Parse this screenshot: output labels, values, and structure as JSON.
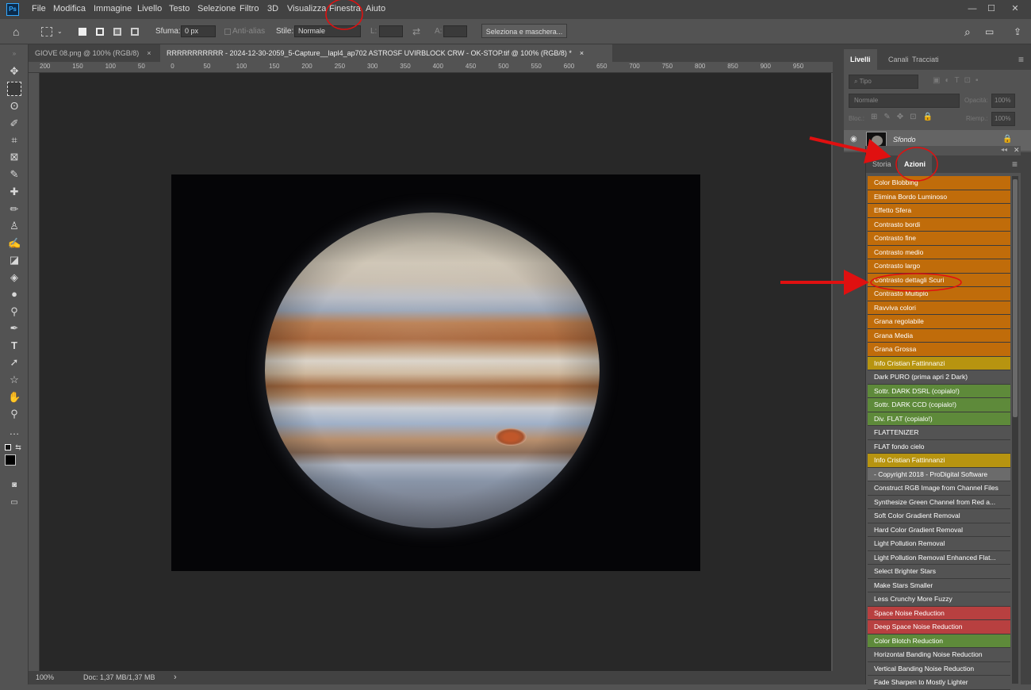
{
  "menubar": {
    "logo": "Ps",
    "items": [
      "File",
      "Modifica",
      "Immagine",
      "Livello",
      "Testo",
      "Selezione",
      "Filtro",
      "3D",
      "Visualizza",
      "Finestra",
      "Aiuto"
    ]
  },
  "options": {
    "sfuma_label": "Sfuma:",
    "sfuma_value": "0 px",
    "antialias_label": "Anti-alias",
    "stile_label": "Stile:",
    "stile_value": "Normale",
    "l_label": "L:",
    "a_label": "A:",
    "mask_button": "Seleziona e maschera..."
  },
  "doc_tabs": [
    {
      "label": "GIOVE 08.png @ 100% (RGB/8)",
      "close": "×"
    },
    {
      "label": "RRRRRRRRRRR - 2024-12-30-2059_5-Capture__lapl4_ap702 ASTROSF UVIRBLOCK CRW - OK-STOP.tif @ 100% (RGB/8) *",
      "close": "×"
    }
  ],
  "ruler_labels": [
    "200",
    "150",
    "100",
    "50",
    "0",
    "50",
    "100",
    "150",
    "200",
    "250",
    "300",
    "350",
    "400",
    "450",
    "500",
    "550",
    "600",
    "650",
    "700",
    "750",
    "800",
    "850",
    "900",
    "950"
  ],
  "statusbar": {
    "zoom": "100%",
    "doc": "Doc: 1,37 MB/1,37 MB",
    "arrow": "›"
  },
  "layers_panel": {
    "tabs": [
      "Livelli",
      "Canali",
      "Tracciati"
    ],
    "filter_placeholder": "Tipo",
    "blend_mode": "Normale",
    "opacity_label": "Opacità:",
    "opacity_value": "100%",
    "lock_label": "Bloc.:",
    "fill_label": "Riemp.:",
    "fill_value": "100%",
    "layer_name": "Sfondo"
  },
  "actions_panel": {
    "tabs": [
      "Storia",
      "Azioni"
    ],
    "items": [
      {
        "label": "Color Blobbing",
        "color": "#c06c0a"
      },
      {
        "label": "Elimina Bordo Luminoso",
        "color": "#c06c0a"
      },
      {
        "label": "Effetto Sfera",
        "color": "#c06c0a"
      },
      {
        "label": "Contrasto bordi",
        "color": "#c06c0a"
      },
      {
        "label": "Contrasto fine",
        "color": "#c06c0a"
      },
      {
        "label": "Contrasto medio",
        "color": "#c06c0a"
      },
      {
        "label": "Contrasto largo",
        "color": "#c06c0a"
      },
      {
        "label": "Contrasto dettagli Scuri",
        "color": "#c06c0a"
      },
      {
        "label": "Contrasto Multiplo",
        "color": "#c06c0a"
      },
      {
        "label": "Ravviva colori",
        "color": "#c06c0a"
      },
      {
        "label": "Grana regolabile",
        "color": "#c06c0a"
      },
      {
        "label": "Grana Media",
        "color": "#c06c0a"
      },
      {
        "label": "Grana Grossa",
        "color": "#c06c0a"
      },
      {
        "label": "Info Cristian Fattinnanzi",
        "color": "#b79410"
      },
      {
        "label": "Dark PURO (prima apri 2 Dark)",
        "color": "#535353"
      },
      {
        "label": "Sottr. DARK DSRL (copialo!)",
        "color": "#5e8a3a"
      },
      {
        "label": "Sottr. DARK CCD (copialo!)",
        "color": "#5e8a3a"
      },
      {
        "label": "Div. FLAT (copialo!)",
        "color": "#5e8a3a"
      },
      {
        "label": "FLATTENIZER",
        "color": "#535353"
      },
      {
        "label": "FLAT fondo cielo",
        "color": "#535353"
      },
      {
        "label": "Info Cristian Fattinnanzi",
        "color": "#b79410"
      },
      {
        "label": "- Copyright 2018 - ProDigital Software",
        "color": "#6b6b6b"
      },
      {
        "label": "Construct RGB Image from Channel Files",
        "color": "#535353"
      },
      {
        "label": "Synthesize Green Channel from Red a...",
        "color": "#535353"
      },
      {
        "label": "Soft Color Gradient Removal",
        "color": "#535353"
      },
      {
        "label": "Hard Color Gradient Removal",
        "color": "#535353"
      },
      {
        "label": "Light Pollution Removal",
        "color": "#535353"
      },
      {
        "label": "Light Pollution Removal Enhanced Flat...",
        "color": "#535353"
      },
      {
        "label": "Select Brighter Stars",
        "color": "#535353"
      },
      {
        "label": "Make Stars Smaller",
        "color": "#535353"
      },
      {
        "label": "Less Crunchy More Fuzzy",
        "color": "#535353"
      },
      {
        "label": "Space Noise Reduction",
        "color": "#b84040"
      },
      {
        "label": "Deep Space Noise Reduction",
        "color": "#b84040"
      },
      {
        "label": "Color Blotch Reduction",
        "color": "#5e8a3a"
      },
      {
        "label": "Horizontal Banding Noise Reduction",
        "color": "#535353"
      },
      {
        "label": "Vertical Banding Noise Reduction",
        "color": "#535353"
      },
      {
        "label": "Fade Sharpen to Mostly Lighter",
        "color": "#535353"
      }
    ]
  },
  "annotation_color": "#e01010"
}
